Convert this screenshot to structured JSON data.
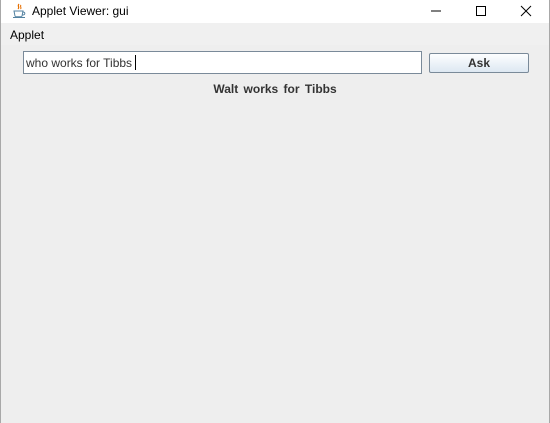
{
  "window": {
    "title": "Applet Viewer: gui",
    "icon": "java-cup-icon",
    "controls": {
      "minimize": "minimize-icon",
      "maximize": "maximize-icon",
      "close": "close-icon"
    }
  },
  "menubar": {
    "items": [
      {
        "label": "Applet"
      }
    ]
  },
  "form": {
    "question": {
      "value": "who works for Tibbs",
      "placeholder": ""
    },
    "ask_label": "Ask",
    "answer": "Walt works for Tibbs"
  },
  "colors": {
    "background": "#eeeeee",
    "titlebar": "#ffffff",
    "text": "#333333",
    "input_border": "#7a8a99"
  }
}
